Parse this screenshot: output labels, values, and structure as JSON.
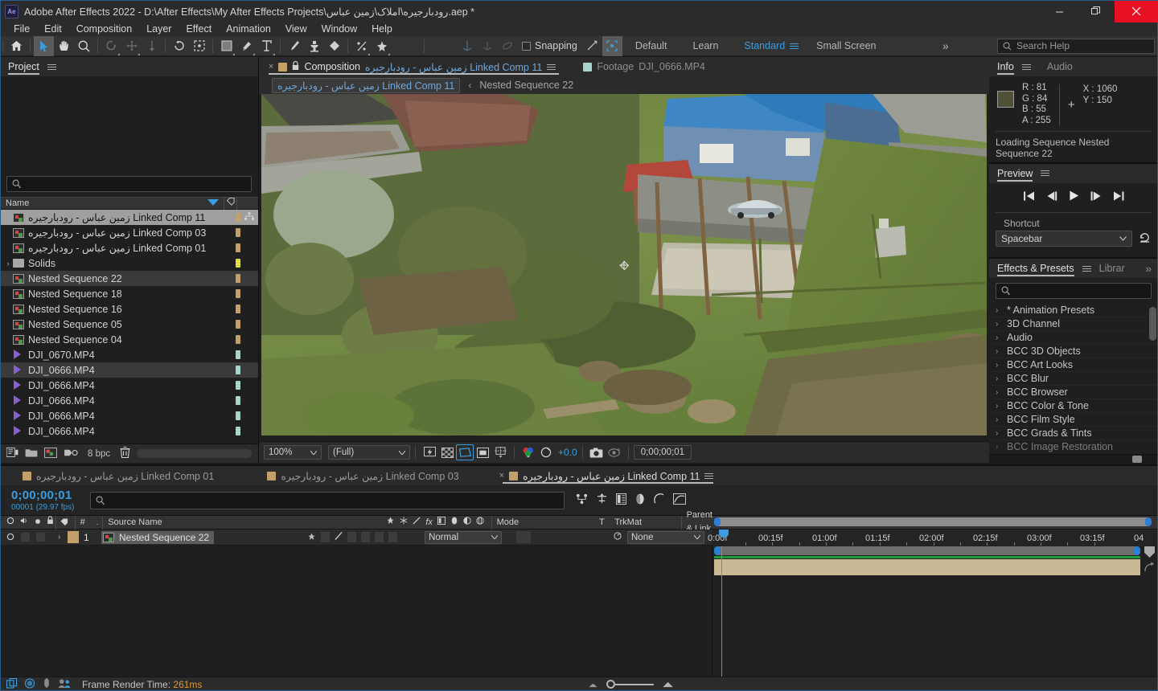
{
  "titlebar": {
    "logo": "Ae",
    "title": "Adobe After Effects 2022 - D:\\After Effects\\My After Effects Projects\\رودبارجیره\\املاک\\زمین عباس.aep *",
    "minimize_icon": "minimize-icon",
    "maximize_icon": "restore-icon",
    "close_icon": "close-icon"
  },
  "menubar": {
    "items": [
      "File",
      "Edit",
      "Composition",
      "Layer",
      "Effect",
      "Animation",
      "View",
      "Window",
      "Help"
    ]
  },
  "toolbar": {
    "tools": [
      {
        "name": "home-icon",
        "active": false
      },
      {
        "name": "selection-tool-icon",
        "active": true
      },
      {
        "name": "hand-tool-icon",
        "active": false
      },
      {
        "name": "zoom-tool-icon",
        "active": false
      },
      {
        "name": "rotation-tool-icon",
        "active": false
      },
      {
        "name": "unified-camera-tool-icon",
        "active": false
      },
      {
        "name": "pan-behind-tool-icon",
        "active": false
      },
      {
        "name": "rotate-tool-icon",
        "active": false
      },
      {
        "name": "region-of-interest-icon",
        "active": false
      },
      {
        "name": "shape-tool-icon",
        "active": false
      },
      {
        "name": "pen-tool-icon",
        "active": false
      },
      {
        "name": "type-tool-icon",
        "active": false
      },
      {
        "name": "brush-tool-icon",
        "active": false
      },
      {
        "name": "clone-stamp-tool-icon",
        "active": false
      },
      {
        "name": "eraser-tool-icon",
        "active": false
      },
      {
        "name": "roto-brush-tool-icon",
        "active": false
      },
      {
        "name": "puppet-pin-tool-icon",
        "active": false
      }
    ],
    "snapping_label": "Snapping",
    "workspaces": [
      {
        "label": "Default",
        "selected": false
      },
      {
        "label": "Learn",
        "selected": false
      },
      {
        "label": "Standard",
        "selected": true
      },
      {
        "label": "Small Screen",
        "selected": false
      }
    ],
    "overflow_label": "»",
    "search_help_placeholder": "Search Help"
  },
  "project": {
    "tab_label": "Project",
    "search_placeholder": "",
    "column_header": "Name",
    "items": [
      {
        "label": "زمین عباس - رودبارجیره Linked Comp 11",
        "icon": "composition-icon",
        "selected": true,
        "swatch": "#c3a06a",
        "badge": "nested-network-icon",
        "indent": false
      },
      {
        "label": "زمین عباس - رودبارجیره Linked Comp 03",
        "icon": "composition-icon",
        "selected": false,
        "swatch": "#c3a06a",
        "indent": false
      },
      {
        "label": "زمین عباس - رودبارجیره Linked Comp 01",
        "icon": "composition-icon",
        "selected": false,
        "swatch": "#c3a06a",
        "indent": false
      },
      {
        "label": "Solids",
        "icon": "folder-icon",
        "selected": false,
        "swatch": "#e0dc4a",
        "disclosure": true,
        "indent": false
      },
      {
        "label": "Nested Sequence 22",
        "icon": "composition-icon",
        "selected": false,
        "highlighted": true,
        "swatch": "#c3a06a",
        "indent": false
      },
      {
        "label": "Nested Sequence 18",
        "icon": "composition-icon",
        "selected": false,
        "swatch": "#c3a06a",
        "indent": false
      },
      {
        "label": "Nested Sequence 16",
        "icon": "composition-icon",
        "selected": false,
        "swatch": "#c3a06a",
        "indent": false
      },
      {
        "label": "Nested Sequence 05",
        "icon": "composition-icon",
        "selected": false,
        "swatch": "#c3a06a",
        "indent": false
      },
      {
        "label": "Nested Sequence 04",
        "icon": "composition-icon",
        "selected": false,
        "swatch": "#c3a06a",
        "indent": false
      },
      {
        "label": "DJI_0670.MP4",
        "icon": "video-icon",
        "selected": false,
        "swatch": "#a8d4cc",
        "indent": false
      },
      {
        "label": "DJI_0666.MP4",
        "icon": "video-icon",
        "selected": false,
        "highlighted": true,
        "swatch": "#a8d4cc",
        "indent": false
      },
      {
        "label": "DJI_0666.MP4",
        "icon": "video-icon",
        "selected": false,
        "swatch": "#a8d4cc",
        "indent": false
      },
      {
        "label": "DJI_0666.MP4",
        "icon": "video-icon",
        "selected": false,
        "swatch": "#a8d4cc",
        "indent": false
      },
      {
        "label": "DJI_0666.MP4",
        "icon": "video-icon",
        "selected": false,
        "swatch": "#a8d4cc",
        "indent": false
      },
      {
        "label": "DJI_0666.MP4",
        "icon": "video-icon",
        "selected": false,
        "swatch": "#a8d4cc",
        "indent": false
      }
    ],
    "footer": {
      "bpc_label": "8 bpc",
      "icons": [
        "interpret-footage-icon",
        "new-folder-icon",
        "new-composition-icon",
        "project-settings-icon",
        "delete-icon"
      ]
    }
  },
  "viewer": {
    "tabs": [
      {
        "close": "×",
        "chip_color": "#c3a06a",
        "lock": "lock-icon",
        "prefix": "Composition",
        "label": "زمین عباس - رودبارجیره Linked Comp 11",
        "active": true
      },
      {
        "chip_color": "#a8d4cc",
        "prefix": "Footage",
        "label": "DJI_0666.MP4",
        "active": false
      }
    ],
    "breadcrumb": {
      "current": "زمین عباس - رودبارجیره Linked Comp 11",
      "separator": "‹",
      "next": "Nested Sequence 22"
    },
    "bottombar": {
      "magnification": "100%",
      "resolution": "(Full)",
      "exposure": "+0.0",
      "timecode": "0;00;00;01",
      "buttons": [
        {
          "name": "fast-previews-icon",
          "on": false
        },
        {
          "name": "toggle-transparency-grid-icon",
          "on": false
        },
        {
          "name": "toggle-mask-paths-icon",
          "on": true
        },
        {
          "name": "region-of-interest-icon",
          "on": false
        },
        {
          "name": "toggle-guides-icon",
          "on": false
        },
        {
          "name": "channel-rgb-icon",
          "on": false
        },
        {
          "name": "reset-exposure-icon",
          "on": false
        },
        {
          "name": "take-snapshot-icon",
          "on": false
        },
        {
          "name": "show-snapshot-icon",
          "on": false
        }
      ]
    }
  },
  "info": {
    "tabs": [
      {
        "label": "Info",
        "active": true
      },
      {
        "label": "Audio",
        "active": false
      }
    ],
    "swatch_color": "#515138",
    "r_label": "R :",
    "r_value": "81",
    "g_label": "G :",
    "g_value": "84",
    "b_label": "B :",
    "b_value": "55",
    "a_label": "A :",
    "a_value": "255",
    "x_label": "X :",
    "x_value": "1060",
    "y_label": "Y :",
    "y_value": "150",
    "status": "Loading Sequence Nested Sequence 22"
  },
  "preview": {
    "tab_label": "Preview",
    "transport": [
      "first-frame-icon",
      "previous-frame-icon",
      "play-icon",
      "next-frame-icon",
      "last-frame-icon"
    ],
    "shortcut_label": "Shortcut",
    "shortcut_value": "Spacebar",
    "reset_icon": "reset-icon"
  },
  "effects": {
    "tabs": [
      {
        "label": "Effects & Presets",
        "active": true
      },
      {
        "label": "Librar",
        "active": false
      }
    ],
    "overflow": "»",
    "search_placeholder": "",
    "items": [
      "* Animation Presets",
      "3D Channel",
      "Audio",
      "BCC 3D Objects",
      "BCC Art Looks",
      "BCC Blur",
      "BCC Browser",
      "BCC Color & Tone",
      "BCC Film Style",
      "BCC Grads & Tints",
      "BCC Image Restoration"
    ]
  },
  "timeline": {
    "tabs": [
      {
        "chip_color": "#c3a06a",
        "label": "زمین عباس - رودبارجیره Linked Comp 01",
        "active": false
      },
      {
        "chip_color": "#c3a06a",
        "label": "زمین عباس - رودبارجیره Linked Comp 03",
        "active": false
      },
      {
        "close": "×",
        "chip_color": "#c3a06a",
        "label": "زمین عباس - رودبارجیره Linked Comp 11",
        "active": true
      }
    ],
    "current_time": "0;00;00;01",
    "frame_info": "00001 (29.97 fps)",
    "search_placeholder": "",
    "tool_icons": [
      "composition-mini-flowchart-icon",
      "draft-3d-icon",
      "hide-shy-layers-icon",
      "frame-blending-icon",
      "motion-blur-icon",
      "graph-editor-icon"
    ],
    "columns": {
      "av_icons": [
        "video-toggle-icon",
        "audio-toggle-icon",
        "solo-icon",
        "lock-icon"
      ],
      "label_icon": "label-tag-icon",
      "index": "#",
      "source_name": "Source Name",
      "switches": [
        "shy-icon",
        "collapse-icon",
        "quality-icon",
        "effects-icon",
        "frame-blend-icon",
        "motion-blur-icon",
        "adjustment-icon",
        "3d-layer-icon"
      ],
      "mode": "Mode",
      "t": "T",
      "trkmat": "TrkMat",
      "parent_link": "Parent & Link"
    },
    "layers": [
      {
        "index": "1",
        "name": "Nested Sequence 22",
        "mode": "Normal",
        "trkmat": "",
        "parent": "None",
        "label_color": "#c3a06a",
        "bar_color": "#cbb894"
      }
    ],
    "ruler_ticks": [
      "0:00f",
      "00:15f",
      "01:00f",
      "01:15f",
      "02:00f",
      "02:15f",
      "03:00f",
      "03:15f",
      "04"
    ],
    "playhead_position_pct": 1.2
  },
  "statusbar": {
    "icons": [
      "render-queue-icon",
      "sync-settings-icon",
      "puppet-icon",
      "team-icon"
    ],
    "frame_render_label": "Frame Render Time:",
    "frame_render_value": "261ms"
  }
}
